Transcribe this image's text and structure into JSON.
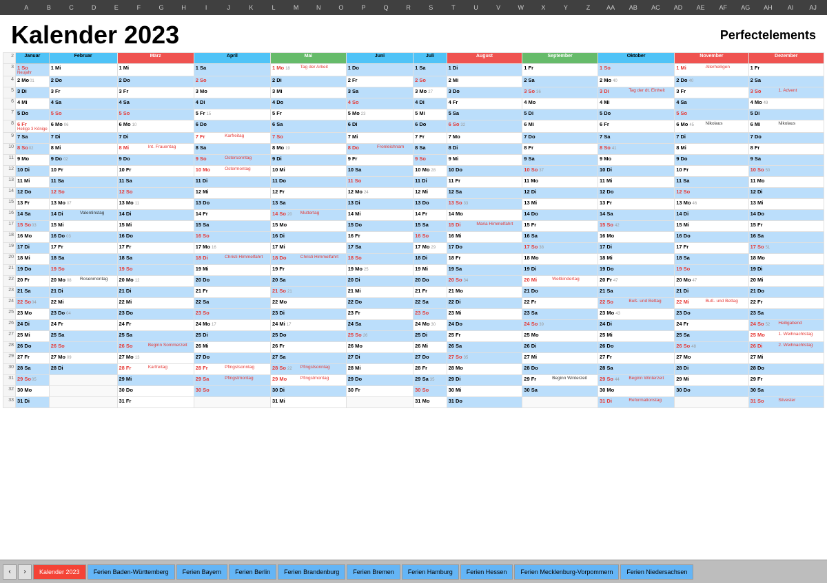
{
  "title": "Kalender 2023",
  "brand": "Perfectelements",
  "colHeaders": [
    "A",
    "B",
    "C",
    "D",
    "E",
    "F",
    "G",
    "H",
    "I",
    "J",
    "K",
    "L",
    "M",
    "N",
    "O",
    "P",
    "Q",
    "R",
    "S",
    "T",
    "U",
    "V",
    "W",
    "X",
    "Y",
    "Z",
    "AA",
    "AB",
    "AC",
    "AD",
    "AE",
    "AF",
    "AG",
    "AH",
    "AI",
    "AJ"
  ],
  "months": [
    "Februar",
    "März",
    "April",
    "Mai",
    "Juni",
    "Juli",
    "August",
    "September",
    "Oktober",
    "November",
    "Dezember"
  ],
  "tabs": [
    "Kalender 2023",
    "Ferien Baden-Württemberg",
    "Ferien Bayern",
    "Ferien Berlin",
    "Ferien Brandenburg",
    "Ferien Bremen",
    "Ferien Hamburg",
    "Ferien Hessen",
    "Ferien Mecklenburg-Vorpommern",
    "Ferien Niedersachsen"
  ]
}
